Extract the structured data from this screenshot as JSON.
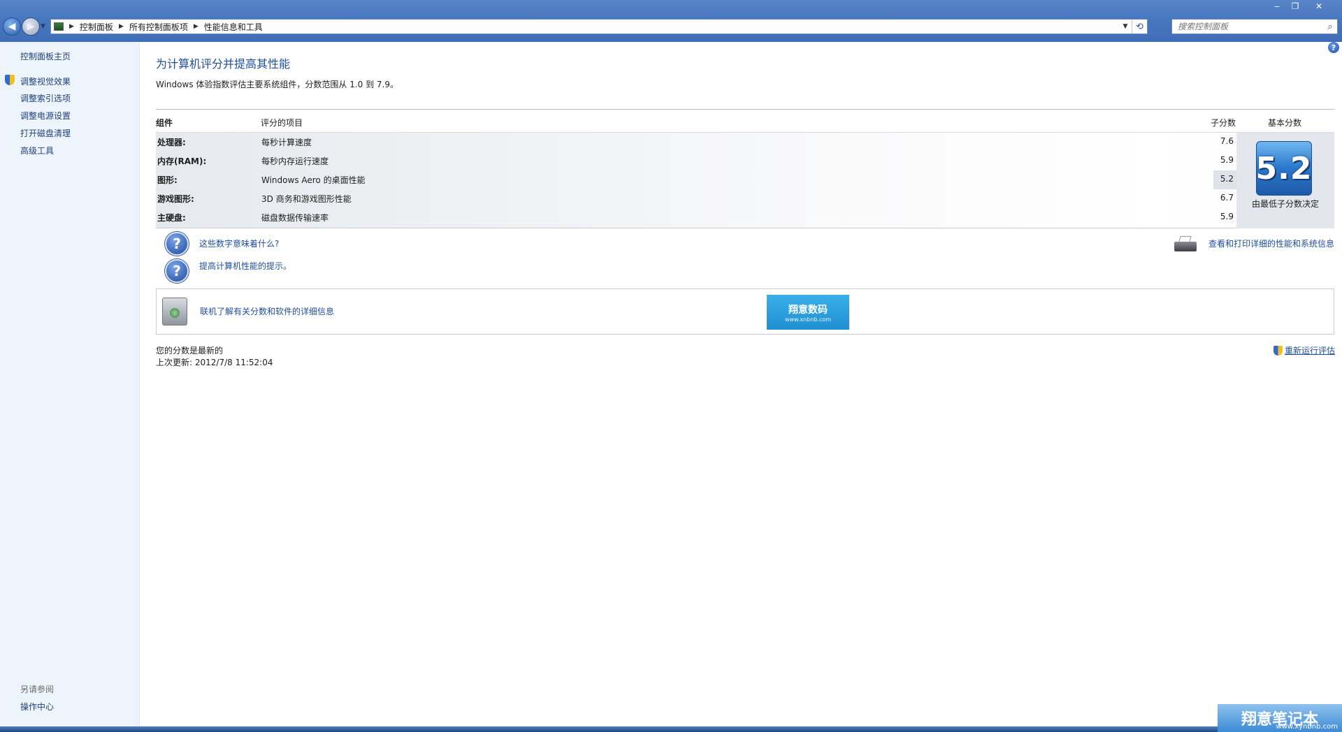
{
  "window": {
    "controls": {
      "minimize": "‒",
      "maximize": "❐",
      "close": "✕"
    }
  },
  "address": {
    "breadcrumbs": [
      "控制面板",
      "所有控制面板项",
      "性能信息和工具"
    ],
    "search_placeholder": "搜索控制面板"
  },
  "sidebar": {
    "items": [
      "控制面板主页",
      "调整视觉效果",
      "调整索引选项",
      "调整电源设置",
      "打开磁盘清理",
      "高级工具"
    ],
    "see_also_heading": "另请参阅",
    "see_also_items": [
      "操作中心"
    ]
  },
  "main": {
    "title": "为计算机评分并提高其性能",
    "description": "Windows 体验指数评估主要系统组件，分数范围从 1.0 到 7.9。",
    "table": {
      "headers": {
        "component": "组件",
        "rated": "评分的项目",
        "subscore": "子分数",
        "basescore": "基本分数"
      },
      "rows": [
        {
          "label": "处理器:",
          "item": "每秒计算速度",
          "score": "7.6"
        },
        {
          "label": "内存(RAM):",
          "item": "每秒内存运行速度",
          "score": "5.9"
        },
        {
          "label": "图形:",
          "item": "Windows Aero 的桌面性能",
          "score": "5.2"
        },
        {
          "label": "游戏图形:",
          "item": "3D 商务和游戏图形性能",
          "score": "6.7"
        },
        {
          "label": "主硬盘:",
          "item": "磁盘数据传输速率",
          "score": "5.9"
        }
      ],
      "base_score": "5.2",
      "base_caption": "由最低子分数决定"
    },
    "links": {
      "what_mean": "这些数字意味着什么?",
      "tips": "提高计算机性能的提示。",
      "print_details": "查看和打印详细的性能和系统信息",
      "online": "联机了解有关分数和软件的详细信息"
    },
    "watermark": {
      "main": "翔意数码",
      "sub": "www.xnbnb.com"
    },
    "status": {
      "uptodate": "您的分数是最新的",
      "last_update": "上次更新: 2012/7/8 11:52:04",
      "rerun": "重新运行评估"
    }
  },
  "corner_watermark": {
    "main": "翔意笔记本",
    "sub": "www.xynbnb.com"
  }
}
